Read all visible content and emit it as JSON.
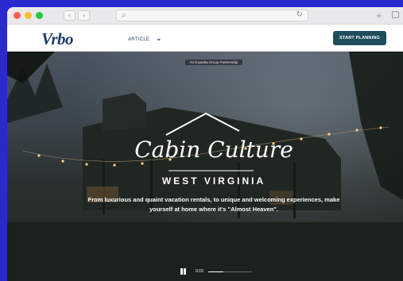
{
  "browser": {
    "nav_back": "‹",
    "nav_forward": "›",
    "search_glyph": "⌕",
    "reload_glyph": "↻",
    "new_tab_glyph": "+"
  },
  "header": {
    "logo": "Vrbo",
    "article_nav": "ARTICLE",
    "cta": "START PLANNING",
    "cta_color": "#1e4d5c"
  },
  "hero": {
    "partnership": "An Expedia Group Partnership",
    "title": "Cabin Culture",
    "subtitle": "WEST VIRGINIA",
    "tagline": "From luxurious and quaint vacation rentals, to unique and welcoming experiences, make yourself at home where it's \"Almost Heaven\"."
  },
  "video": {
    "time": "0:15",
    "progress": 0.35
  },
  "icons": [
    "search-icon",
    "reload-icon",
    "plus-icon",
    "tabs-icon",
    "chevron-down-icon",
    "pause-icon",
    "scroll-down-chevron-icon"
  ]
}
